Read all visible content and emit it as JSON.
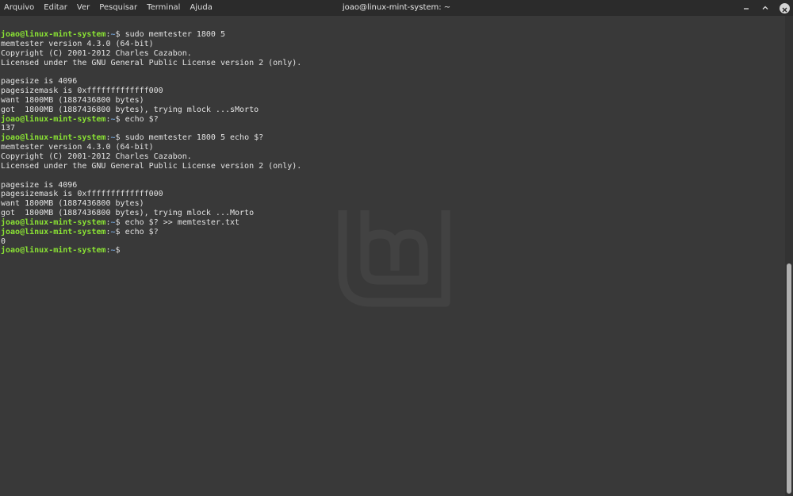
{
  "window": {
    "title": "joao@linux-mint-system: ~",
    "menu": [
      "Arquivo",
      "Editar",
      "Ver",
      "Pesquisar",
      "Terminal",
      "Ajuda"
    ],
    "controls": {
      "minimize": "–",
      "maximize": "⌃",
      "close": "×"
    }
  },
  "terminal": {
    "prompt_user": "joao@linux-mint-system",
    "prompt_path": "~",
    "lines": [
      {
        "type": "cmd",
        "text": " sudo memtester 1800 5"
      },
      {
        "type": "out",
        "text": "memtester version 4.3.0 (64-bit)"
      },
      {
        "type": "out",
        "text": "Copyright (C) 2001-2012 Charles Cazabon."
      },
      {
        "type": "out",
        "text": "Licensed under the GNU General Public License version 2 (only)."
      },
      {
        "type": "out",
        "text": ""
      },
      {
        "type": "out",
        "text": "pagesize is 4096"
      },
      {
        "type": "out",
        "text": "pagesizemask is 0xfffffffffffff000"
      },
      {
        "type": "out",
        "text": "want 1800MB (1887436800 bytes)"
      },
      {
        "type": "out",
        "text": "got  1800MB (1887436800 bytes), trying mlock ...sMorto"
      },
      {
        "type": "cmd",
        "text": " echo $?"
      },
      {
        "type": "out",
        "text": "137"
      },
      {
        "type": "cmd",
        "text": " sudo memtester 1800 5 echo $?"
      },
      {
        "type": "out",
        "text": "memtester version 4.3.0 (64-bit)"
      },
      {
        "type": "out",
        "text": "Copyright (C) 2001-2012 Charles Cazabon."
      },
      {
        "type": "out",
        "text": "Licensed under the GNU General Public License version 2 (only)."
      },
      {
        "type": "out",
        "text": ""
      },
      {
        "type": "out",
        "text": "pagesize is 4096"
      },
      {
        "type": "out",
        "text": "pagesizemask is 0xfffffffffffff000"
      },
      {
        "type": "out",
        "text": "want 1800MB (1887436800 bytes)"
      },
      {
        "type": "out",
        "text": "got  1800MB (1887436800 bytes), trying mlock ...Morto"
      },
      {
        "type": "cmd",
        "text": " echo $? >> memtester.txt"
      },
      {
        "type": "cmd",
        "text": " echo $?"
      },
      {
        "type": "out",
        "text": "0"
      },
      {
        "type": "cmd",
        "text": ""
      }
    ]
  },
  "colors": {
    "prompt_user": "#8ae234",
    "prompt_path": "#729fcf",
    "text": "#e2e2e2",
    "background": "#393939"
  },
  "watermark_icon": "linux-mint-logo"
}
